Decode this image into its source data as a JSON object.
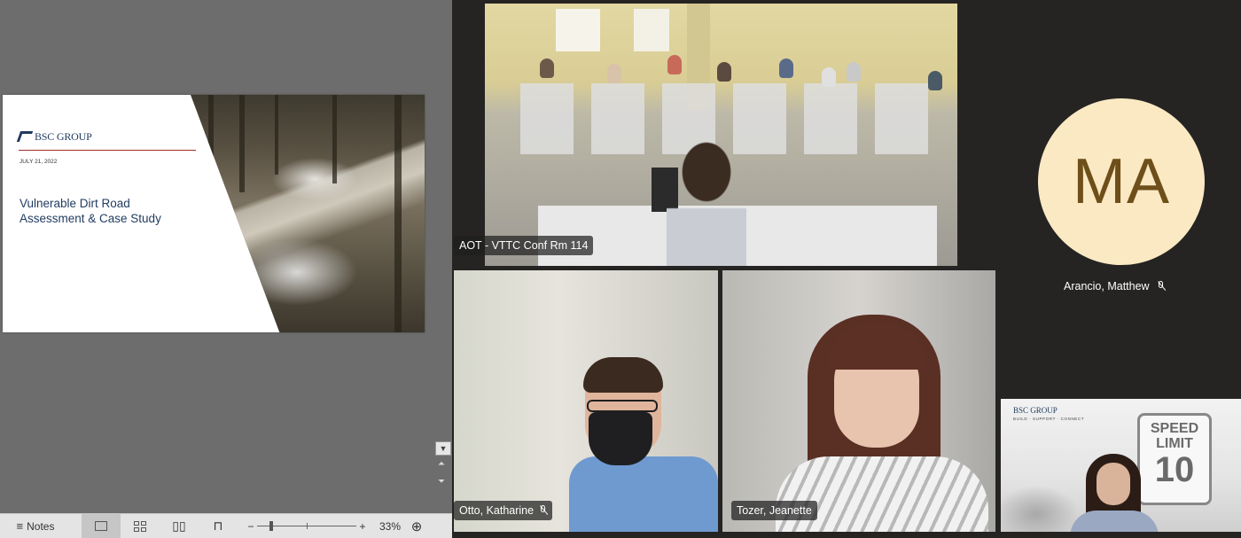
{
  "presentation": {
    "slide": {
      "logo_text": "BSC GROUP",
      "date": "JULY 21, 2022",
      "title_line1": "Vulnerable Dirt Road",
      "title_line2": "Assessment & Case Study"
    },
    "statusbar": {
      "notes_label": "Notes",
      "zoom_minus": "−",
      "zoom_plus": "+",
      "zoom_level": "33%"
    }
  },
  "participants": [
    {
      "name": "AOT - VTTC Conf Rm 114",
      "muted": false
    },
    {
      "name": "Arancio, Matthew",
      "initials": "MA",
      "muted": true,
      "avatar_color": "#fbe9c4"
    },
    {
      "name": "Otto, Katharine",
      "muted": true
    },
    {
      "name": "Tozer, Jeanette",
      "muted": false
    },
    {
      "name": "",
      "background": {
        "logo_text": "BSC GROUP",
        "tagline": "BUILD · SUPPORT · CONNECT",
        "sign_line1": "SPEED",
        "sign_line2": "LIMIT",
        "sign_number": "10"
      }
    }
  ],
  "icons": {
    "mic_muted": "mic-off-icon",
    "notes": "notes-icon",
    "fit": "fit-to-window-icon"
  },
  "colors": {
    "ppt_background": "#6d6d6d",
    "meeting_background": "#252423",
    "slide_title": "#1f3a5f",
    "slide_rule": "#a52a2a"
  }
}
